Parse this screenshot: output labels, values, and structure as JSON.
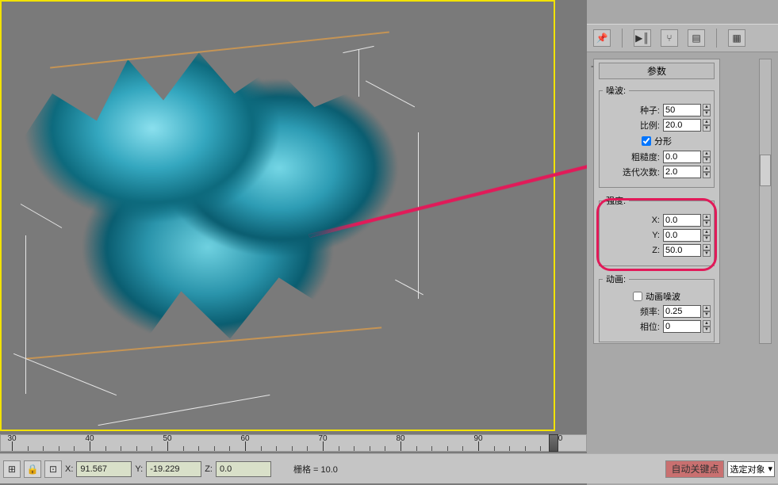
{
  "ruler": {
    "start": 30,
    "end": 100,
    "step": 10
  },
  "statusbar": {
    "x_label": "X:",
    "x_value": "91.567",
    "y_label": "Y:",
    "y_value": "-19.229",
    "z_label": "Z:",
    "z_value": "0.0",
    "grid_label": "栅格 = 10.0",
    "autokey_label": "自动关键点",
    "dropdown_value": "选定对象"
  },
  "panel": {
    "title": "参数",
    "noise_group": "噪波:",
    "seed_label": "种子:",
    "seed_value": "50",
    "scale_label": "比例:",
    "scale_value": "20.0",
    "fractal_label": "分形",
    "rough_label": "粗糙度:",
    "rough_value": "0.0",
    "iter_label": "迭代次数:",
    "iter_value": "2.0",
    "strength_group": "强度:",
    "x_label": "X:",
    "x_value": "0.0",
    "y_label": "Y:",
    "y_value": "0.0",
    "z_label": "Z:",
    "z_value": "50.0",
    "anim_group": "动画:",
    "anim_noise_label": "动画噪波",
    "freq_label": "频率:",
    "freq_value": "0.25",
    "phase_label": "相位:",
    "phase_value": "0"
  },
  "toolbar_icons": [
    "pin-icon",
    "play-pause-icon",
    "fork-icon",
    "layers-icon",
    "prefs-icon"
  ]
}
